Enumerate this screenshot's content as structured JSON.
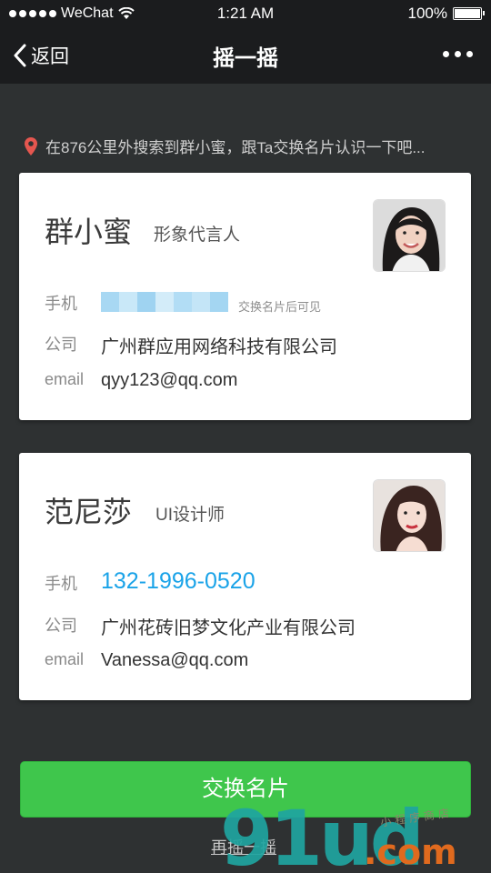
{
  "status_bar": {
    "carrier": "WeChat",
    "time": "1:21 AM",
    "battery": "100%",
    "battery_level": 1.0
  },
  "nav": {
    "back_label": "返回",
    "title": "摇一摇"
  },
  "hint": {
    "text": "在876公里外搜索到群小蜜，跟Ta交换名片认识一下吧..."
  },
  "cards": [
    {
      "name": "群小蜜",
      "title": "形象代言人",
      "phone_label": "手机",
      "phone_note": "交换名片后可见",
      "company_label": "公司",
      "company": "广州群应用网络科技有限公司",
      "email_label": "email",
      "email": "qyy123@qq.com"
    },
    {
      "name": "范尼莎",
      "title": "UI设计师",
      "phone_label": "手机",
      "phone": "132-1996-0520",
      "company_label": "公司",
      "company": "广州花砖旧梦文化产业有限公司",
      "email_label": "email",
      "email": "Vanessa@qq.com"
    }
  ],
  "actions": {
    "exchange_label": "交换名片",
    "shake_again_label": "再摇一摇"
  },
  "watermark": {
    "logo": "91ud",
    "suffix": ".com",
    "subtitle": "小程序商店"
  },
  "colors": {
    "accent_green": "#3fc64c",
    "phone_blue": "#1aa3e8",
    "location_red": "#e5564f"
  }
}
